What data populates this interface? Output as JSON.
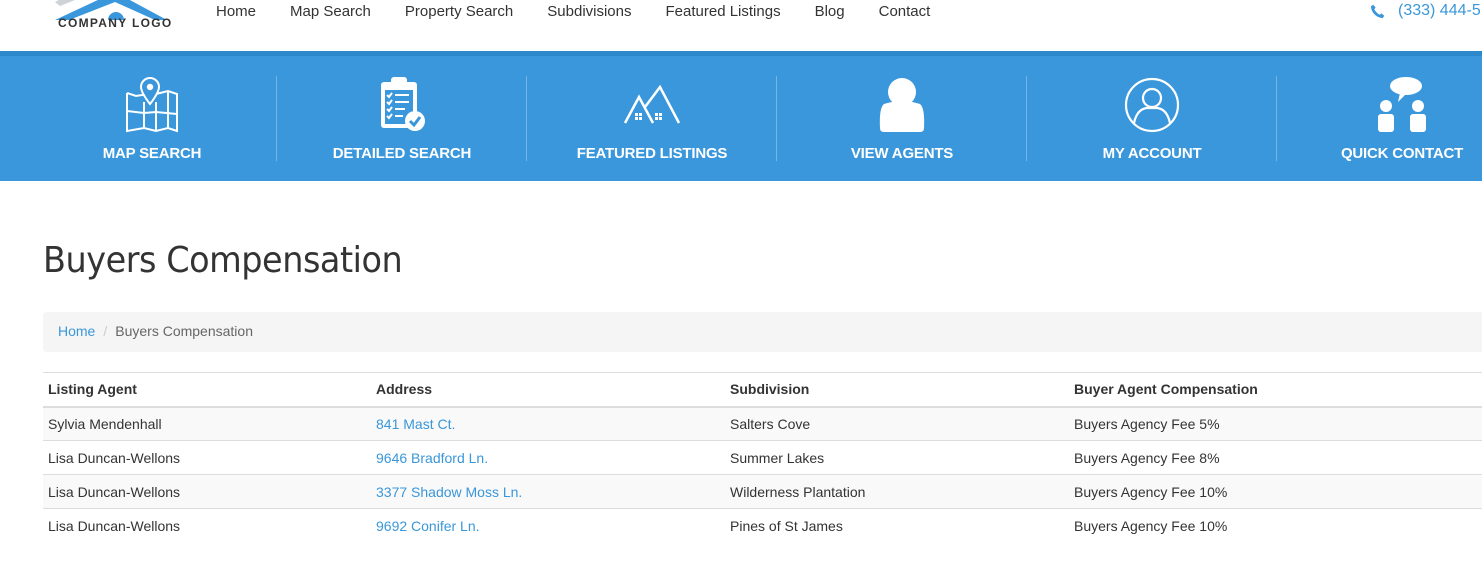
{
  "header": {
    "logo_text": "COMPANY LOGO",
    "nav": [
      "Home",
      "Map Search",
      "Property Search",
      "Subdivisions",
      "Featured Listings",
      "Blog",
      "Contact"
    ],
    "phone": "(333) 444-5"
  },
  "band": {
    "items": [
      {
        "label": "MAP SEARCH",
        "icon": "map-pin-icon"
      },
      {
        "label": "DETAILED SEARCH",
        "icon": "clipboard-check-icon"
      },
      {
        "label": "FEATURED LISTINGS",
        "icon": "houses-icon"
      },
      {
        "label": "VIEW AGENTS",
        "icon": "person-icon"
      },
      {
        "label": "MY ACCOUNT",
        "icon": "user-circle-icon"
      },
      {
        "label": "QUICK CONTACT",
        "icon": "chat-people-icon"
      }
    ]
  },
  "page": {
    "title": "Buyers Compensation",
    "breadcrumb": {
      "home": "Home",
      "current": "Buyers Compensation"
    }
  },
  "table": {
    "headers": [
      "Listing Agent",
      "Address",
      "Subdivision",
      "Buyer Agent Compensation"
    ],
    "rows": [
      {
        "agent": "Sylvia Mendenhall",
        "address": "841 Mast Ct.",
        "subdivision": "Salters Cove",
        "compensation": "Buyers Agency Fee 5%"
      },
      {
        "agent": "Lisa Duncan-Wellons",
        "address": "9646 Bradford Ln.",
        "subdivision": "Summer Lakes",
        "compensation": "Buyers Agency Fee 8%"
      },
      {
        "agent": "Lisa Duncan-Wellons",
        "address": "3377 Shadow Moss Ln.",
        "subdivision": "Wilderness Plantation",
        "compensation": "Buyers Agency Fee 10%"
      },
      {
        "agent": "Lisa Duncan-Wellons",
        "address": "9692 Conifer Ln.",
        "subdivision": "Pines of St James",
        "compensation": "Buyers Agency Fee 10%"
      }
    ]
  },
  "colors": {
    "accent": "#3a97dc",
    "link": "#3a97d9"
  }
}
